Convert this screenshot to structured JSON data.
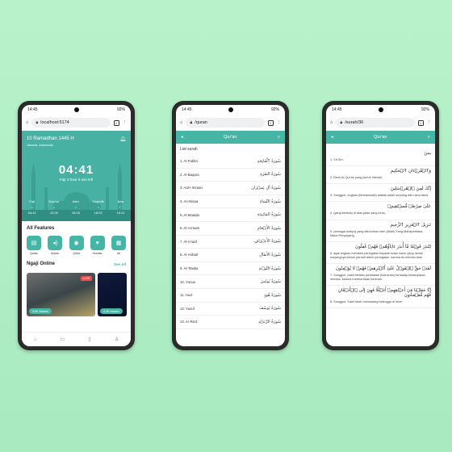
{
  "colors": {
    "accent": "#45b5a5",
    "background": "#b8f2cb",
    "live": "#e9524f"
  },
  "status": {
    "time": "14:45",
    "battery": "92%"
  },
  "phone1": {
    "url": "localhost:5174",
    "tab_count": "1",
    "date": "10 Ramadhan 1445 H",
    "location": "Jakarta, Indonesia",
    "clock": "04:41",
    "countdown": "Fajr 3 hour 9 min left",
    "prayers": [
      {
        "name": "Fajr",
        "time": "04:41"
      },
      {
        "name": "Dzuhur",
        "time": "12:00"
      },
      {
        "name": "Ashr",
        "time": "15:16"
      },
      {
        "name": "Maghrib",
        "time": "18:02"
      },
      {
        "name": "Isha",
        "time": "19:11"
      }
    ],
    "features_title": "All Features",
    "features": [
      {
        "label": "Quran",
        "icon": "book-icon"
      },
      {
        "label": "Adzan",
        "icon": "speaker-icon"
      },
      {
        "label": "Qibla",
        "icon": "compass-icon"
      },
      {
        "label": "Donate",
        "icon": "heart-icon"
      },
      {
        "label": "All",
        "icon": "grid-icon"
      }
    ],
    "ngaji_title": "Ngaji Online",
    "see_all": "See All",
    "videos": [
      {
        "viewers": "3.6K viewers",
        "live": "LIVE"
      },
      {
        "viewers": "4.3K viewers"
      }
    ],
    "nav": [
      "home-icon",
      "calendar-icon",
      "document-icon",
      "user-icon"
    ]
  },
  "phone2": {
    "url": "/quran",
    "tab_count": "1",
    "title": "Qur'an",
    "list_title": "List surah",
    "surahs": [
      {
        "name": "1. Al-Fatiha",
        "arabic": "سُورَةُ ٱلْفَاتِحَةِ"
      },
      {
        "name": "2. Al-Baqara",
        "arabic": "سُورَةُ البَقَرَةِ"
      },
      {
        "name": "3. Aal-i-Imraan",
        "arabic": "سُورَةُ آلِ عِمۡرَانَ"
      },
      {
        "name": "4. An-Nisaa",
        "arabic": "سُورَةُ النِّسَاءِ"
      },
      {
        "name": "5. Al-Maaida",
        "arabic": "سُورَةُ المَائـِدَةِ"
      },
      {
        "name": "6. Al-An'aam",
        "arabic": "سُورَةُ الأَنۡعَامِ"
      },
      {
        "name": "7. Al-A'raaf",
        "arabic": "سُورَةُ الأَعۡرَافِ"
      },
      {
        "name": "8. Al-Anfaal",
        "arabic": "سُورَةُ الأَنفَالِ"
      },
      {
        "name": "9. At-Tawba",
        "arabic": "سُورَةُ التَّوۡبَةِ"
      },
      {
        "name": "10. Yunus",
        "arabic": "سُورَةُ يُونُسَ"
      },
      {
        "name": "11. Hud",
        "arabic": "سُورَةُ هُودٍ"
      },
      {
        "name": "12. Yusuf",
        "arabic": "سُورَةُ يُوسُفَ"
      },
      {
        "name": "13. Ar-Ra'd",
        "arabic": "سُورَةُ الرَّعۡدِ"
      }
    ]
  },
  "phone3": {
    "url": "/surah/36",
    "tab_count": "1",
    "title": "Qur'an",
    "verses": [
      {
        "arabic": "يسٓ",
        "translation": "1. Yā Sīn."
      },
      {
        "arabic": "وَٱلۡقُرۡءَانِ ٱلۡحَكِيمِ",
        "translation": "2. Demi Al-Qur'an yang penuh hikmah,"
      },
      {
        "arabic": "إِنَّكَ لَمِنَ ٱلۡمُرۡسَلِينَ",
        "translation": "3. Sungguh, engkau (Muhammad) adalah salah seorang dari rasul-rasul,"
      },
      {
        "arabic": "عَلَىٰ صِرَٰطٖ مُّسۡتَقِيمٖ",
        "translation": "4. (yang berada) di atas jalan yang lurus,"
      },
      {
        "arabic": "تَنزِيلَ ٱلۡعَزِيزِ ٱلرَّحِيمِ",
        "translation": "5. (sebagai wahyu) yang diturunkan oleh (Allah) Yang Mahaperkasa, Maha Penyayang,"
      },
      {
        "arabic": "لِتُنذِرَ قَوۡمٗا مَّآ أُنذِرَ ءَابَآؤُهُمۡ فَهُمۡ غَٰفِلُونَ",
        "translation": "6. agar engkau memberi peringatan kepada suatu kaum yang nenek moyangnya belum pernah diberi peringatan, karena itu mereka lalai."
      },
      {
        "arabic": "لَقَدۡ حَقَّ ٱلۡقَوۡلُ عَلَىٰٓ أَكۡثَرِهِمۡ فَهُمۡ لَا يُؤۡمِنُونَ",
        "translation": "7. Sungguh, pasti berlaku perkataan (hukuman) terhadap kebanyakan mereka, karena mereka tidak beriman."
      },
      {
        "arabic": "إِنَّا جَعَلۡنَا فِيٓ أَعۡنَٰقِهِمۡ أَغۡلَٰلٗا فَهِيَ إِلَى ٱلۡأَذۡقَانِ فَهُم مُّقۡمَحُونَ",
        "translation": "8. Sungguh, Kami telah memasang belenggu di leher"
      }
    ]
  }
}
